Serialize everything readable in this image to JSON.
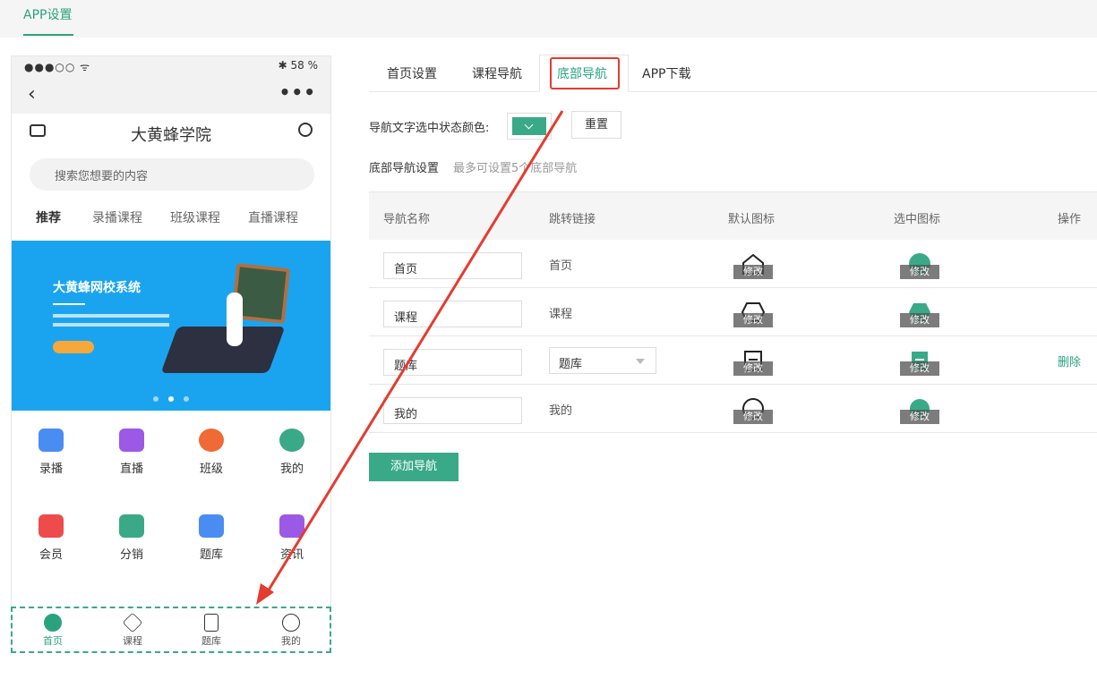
{
  "topbar": {
    "title": "APP设置"
  },
  "phone": {
    "status_left": "●●●○○ ᯤ",
    "status_right": "✱ 58 %",
    "back": "‹",
    "more": "•••",
    "app_name": "大黄蜂学院",
    "search_placeholder": "搜索您想要的内容",
    "tabs": [
      "推荐",
      "录播课程",
      "班级课程",
      "直播课程"
    ],
    "banner": {
      "title": "大黄蜂网校系统"
    },
    "grid": [
      {
        "label": "录播",
        "color": "#4a8df2"
      },
      {
        "label": "直播",
        "color": "#9b59e6"
      },
      {
        "label": "班级",
        "color": "#f06a35"
      },
      {
        "label": "我的",
        "color": "#3aa988"
      },
      {
        "label": "会员",
        "color": "#ee4b4b"
      },
      {
        "label": "分销",
        "color": "#3aa988"
      },
      {
        "label": "题库",
        "color": "#4a8df2"
      },
      {
        "label": "资讯",
        "color": "#9b59e6"
      }
    ],
    "bottom_nav": [
      "首页",
      "课程",
      "题库",
      "我的"
    ]
  },
  "tabs": [
    "首页设置",
    "课程导航",
    "底部导航",
    "APP下载"
  ],
  "color_label": "导航文字选中状态颜色:",
  "reset_label": "重置",
  "section_label": "底部导航设置",
  "section_hint": "最多可设置5个底部导航",
  "table": {
    "headers": [
      "导航名称",
      "跳转链接",
      "默认图标",
      "选中图标",
      "操作"
    ],
    "rows": [
      {
        "name": "首页",
        "link": "首页",
        "select": false
      },
      {
        "name": "课程",
        "link": "课程",
        "select": false
      },
      {
        "name": "题库",
        "link": "题库",
        "select": true,
        "action": "删除"
      },
      {
        "name": "我的",
        "link": "我的",
        "select": false
      }
    ],
    "modify": "修改"
  },
  "add_button": "添加导航",
  "colors": {
    "accent": "#3aa988",
    "highlight": "#e53b30"
  }
}
